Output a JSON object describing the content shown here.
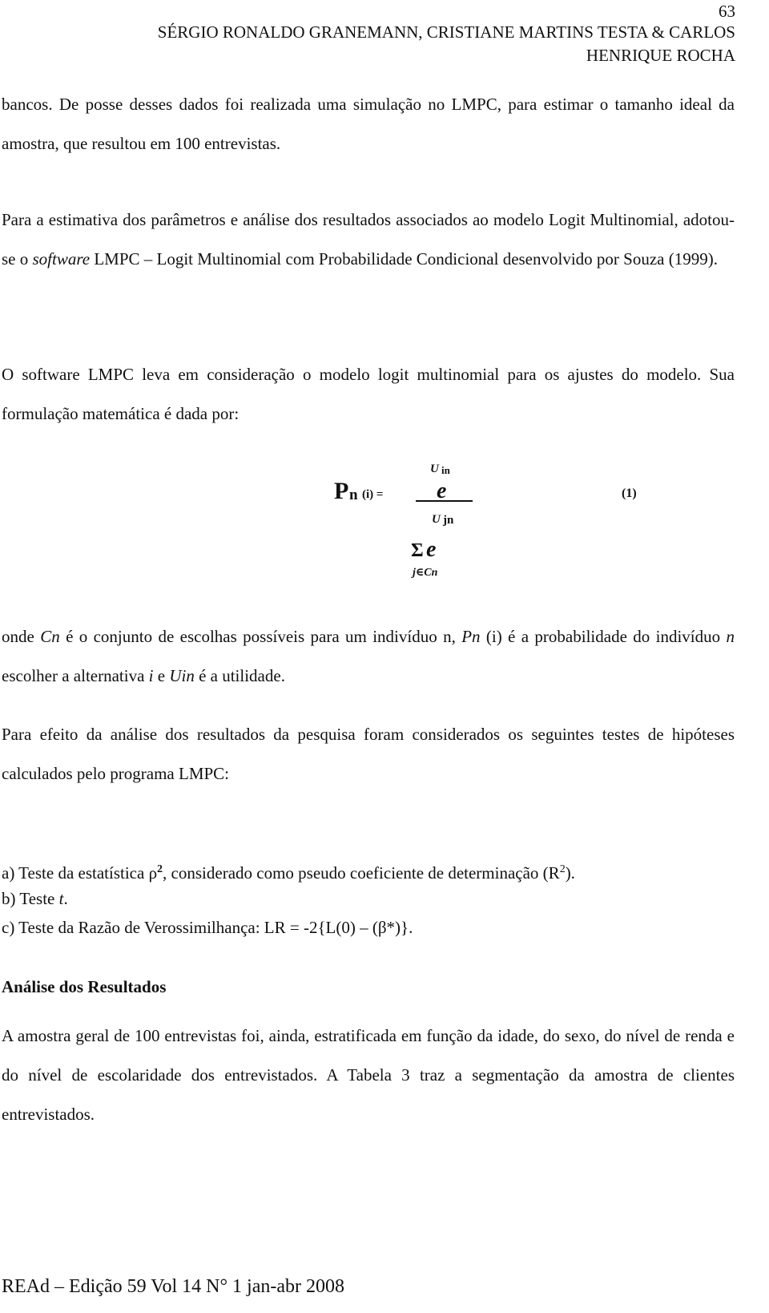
{
  "header": {
    "page_number": "63",
    "authors_line1": "SÉRGIO RONALDO GRANEMANN, CRISTIANE MARTINS TESTA & CARLOS",
    "authors_line2": "HENRIQUE ROCHA"
  },
  "paragraphs": {
    "p1": "bancos. De posse desses dados foi realizada uma simulação no LMPC, para estimar o tamanho ideal da amostra, que resultou em 100 entrevistas.",
    "p2_a": "Para a estimativa dos parâmetros e análise dos resultados associados ao modelo Logit Multinomial, adotou-se o ",
    "p2_em": "software",
    "p2_b": " LMPC – Logit Multinomial com Probabilidade Condicional desenvolvido por Souza (1999).",
    "p3": "O software LMPC leva em consideração o modelo logit multinomial para os ajustes do modelo. Sua formulação matemática é dada por:",
    "p4": {
      "t1": "onde ",
      "cn": "Cn",
      "t2": " é o conjunto de escolhas possíveis para um indivíduo n, ",
      "pn": "Pn",
      "t3": " (i) é a probabilidade do indivíduo ",
      "n": "n",
      "t4": " escolher a alternativa ",
      "i": "i",
      "t5": " e ",
      "uin": "Uin",
      "t6": " é a utilidade."
    },
    "p5": "Para efeito da análise dos resultados da pesquisa foram considerados os seguintes testes de hipóteses calculados pelo programa LMPC:"
  },
  "formula": {
    "lhs_P": "P",
    "lhs_sub": "n",
    "lhs_arg": "(i) =",
    "num_exp_U": "U",
    "num_exp_sub": "in",
    "num_base": "e",
    "den_exp_U": "U",
    "den_exp_sub": "jn",
    "den_sigma": "Σ",
    "den_base": "e",
    "den_index": "j∈Cn",
    "equation_number": "(1)"
  },
  "list": {
    "a_pre": "a) Teste da estatística ρ",
    "a_sup": "2",
    "a_mid": ",  considerado como pseudo coeficiente de determinação (R",
    "a_sup2": "2",
    "a_end": ").",
    "b_pre": "b)  Teste ",
    "b_em": "t",
    "b_end": ".",
    "c": "c)  Teste da Razão de Verossimilhança: LR = -2{L(0) – (β*)}."
  },
  "section": {
    "title": "Análise dos Resultados",
    "body": "A amostra geral de 100 entrevistas foi, ainda, estratificada em função da idade, do sexo, do nível de renda e do nível de escolaridade dos entrevistados. A Tabela 3 traz a segmentação da amostra de clientes entrevistados."
  },
  "footer": {
    "text": "REAd – Edição 59 Vol 14 N° 1 jan-abr 2008"
  }
}
